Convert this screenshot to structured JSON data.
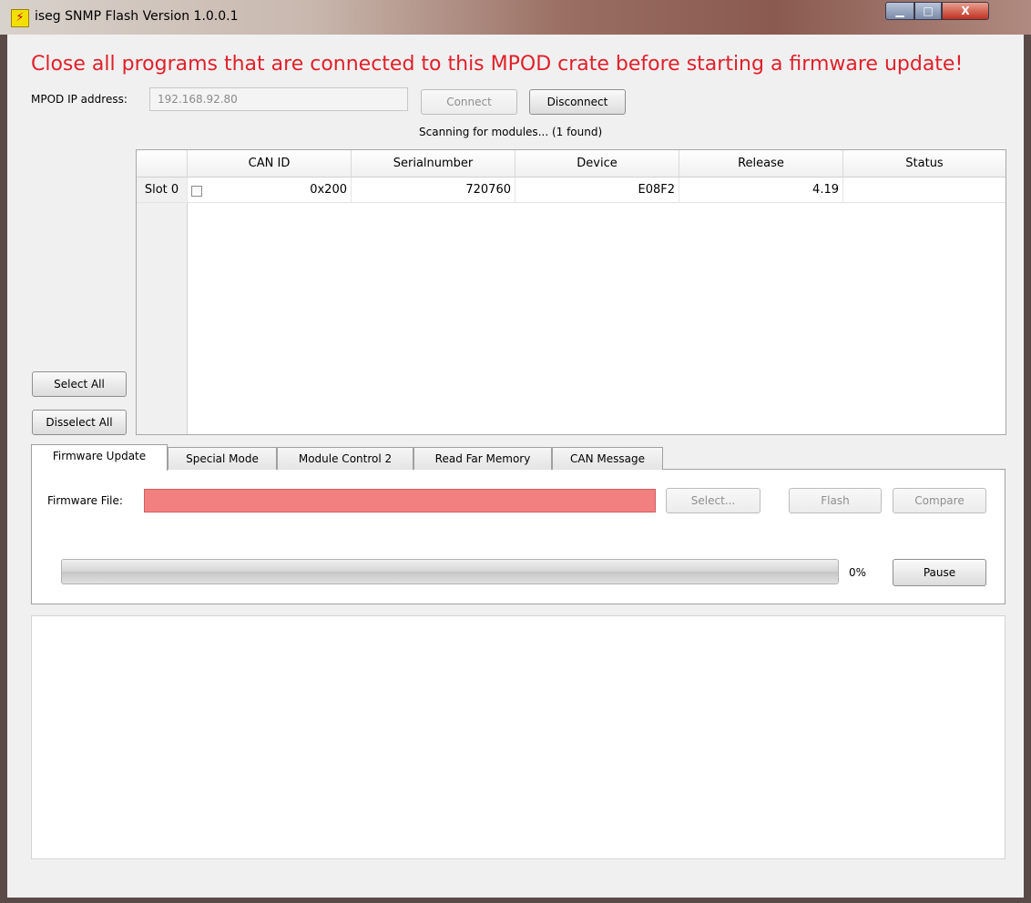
{
  "window": {
    "title": "iseg SNMP Flash Version 1.0.0.1",
    "app_icon_glyph": "⚡",
    "controls": {
      "minimize": "▁",
      "maximize": "□",
      "close": "X"
    }
  },
  "warning_text": "Close all programs that are connected to this MPOD crate before starting a firmware update!",
  "connection": {
    "ip_label": "MPOD IP address:",
    "ip_value": "192.168.92.80",
    "connect_label": "Connect",
    "disconnect_label": "Disconnect"
  },
  "scan_status": "Scanning for modules... (1 found)",
  "table": {
    "columns": [
      "CAN ID",
      "Serialnumber",
      "Device",
      "Release",
      "Status"
    ],
    "rows": [
      {
        "slot": "Slot 0",
        "checked": false,
        "can_id": "0x200",
        "serial": "720760",
        "device": "E08F2",
        "release": "4.19",
        "status": ""
      }
    ]
  },
  "side_buttons": {
    "select_all": "Select All",
    "deselect_all": "Disselect All"
  },
  "tabs": [
    "Firmware Update",
    "Special Mode",
    "Module Control 2",
    "Read Far Memory",
    "CAN Message"
  ],
  "firmware": {
    "file_label": "Firmware File:",
    "file_value": "",
    "select_label": "Select...",
    "flash_label": "Flash",
    "compare_label": "Compare",
    "progress_text": "0%",
    "progress_value": 0,
    "pause_label": "Pause"
  },
  "colors": {
    "warning": "#e0202a",
    "invalid_field": "#f38080"
  }
}
